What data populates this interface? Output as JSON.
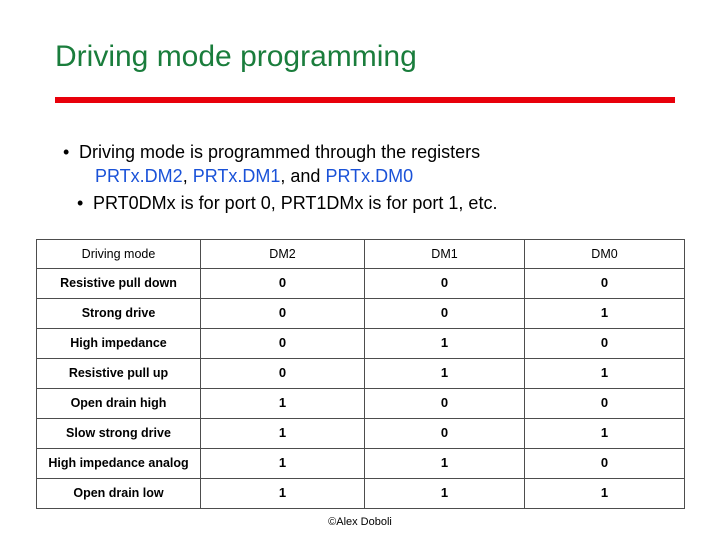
{
  "slide": {
    "title": "Driving mode programming",
    "bullets": {
      "b1_part1": "Driving mode is programmed through the registers",
      "b1_reg1": "PRTx.DM2",
      "b1_sep1": ", ",
      "b1_reg2": "PRTx.DM1",
      "b1_sep2": ", and ",
      "b1_reg3": "PRTx.DM0",
      "b2": "PRT0DMx is for port 0, PRT1DMx is for port 1, etc.",
      "marker": "•"
    },
    "table": {
      "headers": [
        "Driving mode",
        "DM2",
        "DM1",
        "DM0"
      ],
      "rows": [
        {
          "mode": "Resistive pull down",
          "dm2": "0",
          "dm1": "0",
          "dm0": "0"
        },
        {
          "mode": "Strong drive",
          "dm2": "0",
          "dm1": "0",
          "dm0": "1"
        },
        {
          "mode": "High impedance",
          "dm2": "0",
          "dm1": "1",
          "dm0": "0"
        },
        {
          "mode": "Resistive pull up",
          "dm2": "0",
          "dm1": "1",
          "dm0": "1"
        },
        {
          "mode": "Open drain high",
          "dm2": "1",
          "dm1": "0",
          "dm0": "0"
        },
        {
          "mode": "Slow strong drive",
          "dm2": "1",
          "dm1": "0",
          "dm0": "1"
        },
        {
          "mode": "High impedance analog",
          "dm2": "1",
          "dm1": "1",
          "dm0": "0"
        },
        {
          "mode": "Open drain low",
          "dm2": "1",
          "dm1": "1",
          "dm0": "1"
        }
      ]
    },
    "footer": "©Alex Doboli",
    "colors": {
      "title": "#1a7d3c",
      "rule": "#e8000b",
      "register_text": "#1a52d8",
      "border": "#4d4d4d"
    }
  }
}
